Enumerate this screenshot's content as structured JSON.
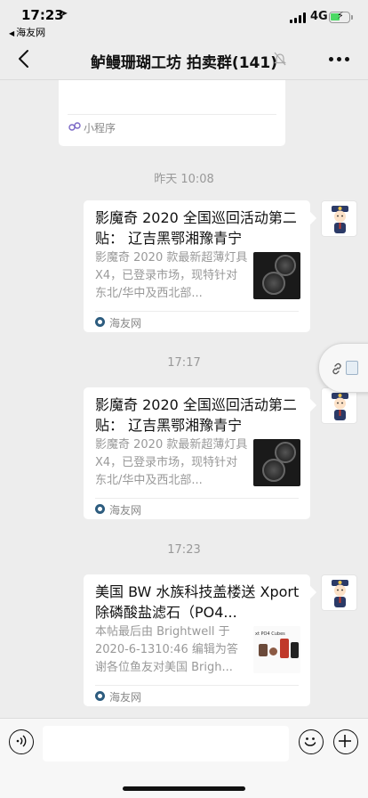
{
  "status_bar": {
    "time": "17:23",
    "back_app": "海友网",
    "network": "4G"
  },
  "header": {
    "title": "鲈鳗珊瑚工坊 拍卖群(141)",
    "back_icon": "chevron-left-icon",
    "mute_icon": "bell-muted-icon",
    "more_icon": "more-dots-icon"
  },
  "messages": {
    "mini_program": {
      "label": "小程序"
    },
    "timestamps": [
      "昨天 10:08",
      "17:17",
      "17:23"
    ],
    "cards": [
      {
        "title": "影魔奇 2020 全国巡回活动第二贴：  辽吉黑鄂湘豫青宁",
        "desc": "影魔奇 2020 款最新超薄灯具 X4，已登录市场，现特针对东北/华中及西北部...",
        "source": "海友网"
      },
      {
        "title": "影魔奇 2020 全国巡回活动第二贴：  辽吉黑鄂湘豫青宁",
        "desc": "影魔奇 2020 款最新超薄灯具 X4，已登录市场，现特针对东北/华中及西北部...",
        "source": "海友网"
      },
      {
        "title": "美国 BW 水族科技盖楼送 Xport 除磷酸盐滤石（PO4...",
        "desc": "本帖最后由 Brightwell 于 2020-6-1310:46 编辑为答谢各位鱼友对美国 Brigh...",
        "source": "海友网",
        "thumb_text": "xt PO4 Cubes"
      }
    ]
  },
  "input_bar": {
    "placeholder": "",
    "voice_icon": "voice-icon",
    "emoji_icon": "emoji-icon",
    "plus_icon": "plus-icon"
  },
  "colors": {
    "background": "#ededed",
    "bubble": "#ffffff",
    "meta_text": "#999999",
    "battery_green": "#4cd964",
    "source_icon": "#2d5c7f"
  }
}
